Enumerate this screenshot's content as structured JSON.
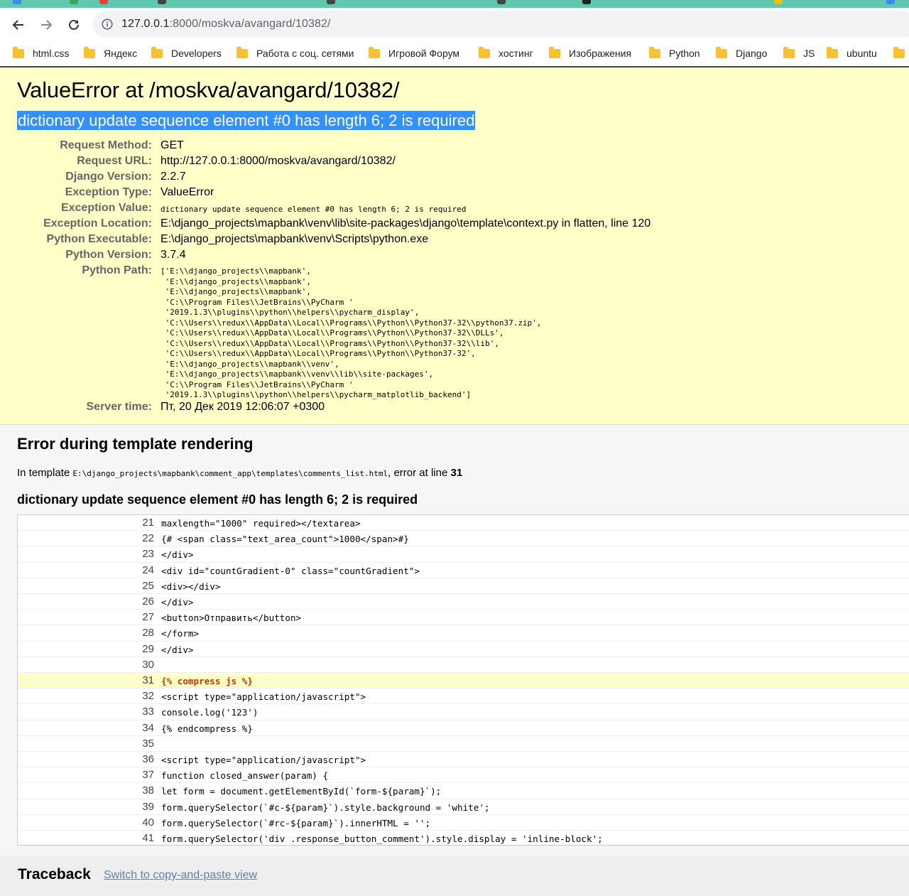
{
  "browser": {
    "url_host": "127.0.0.1",
    "url_path": ":8000/moskva/avangard/10382/",
    "bookmarks": [
      "html.css",
      "Яндекс",
      "Developers",
      "Работа с соц. сетями",
      "Игровой Форум",
      "хостинг",
      "Изображения",
      "Python",
      "Django",
      "JS",
      "ubuntu"
    ]
  },
  "summary": {
    "title": "ValueError at /moskva/avangard/10382/",
    "message": "dictionary update sequence element #0 has length 6; 2 is required",
    "meta": [
      {
        "key": "Request Method:",
        "value": "GET"
      },
      {
        "key": "Request URL:",
        "value": "http://127.0.0.1:8000/moskva/avangard/10382/"
      },
      {
        "key": "Django Version:",
        "value": "2.2.7"
      },
      {
        "key": "Exception Type:",
        "value": "ValueError"
      },
      {
        "key": "Exception Value:",
        "value": "dictionary update sequence element #0 has length 6; 2 is required"
      },
      {
        "key": "Exception Location:",
        "value": "E:\\django_projects\\mapbank\\venv\\lib\\site-packages\\django\\template\\context.py in flatten, line 120"
      },
      {
        "key": "Python Executable:",
        "value": "E:\\django_projects\\mapbank\\venv\\Scripts\\python.exe"
      },
      {
        "key": "Python Version:",
        "value": "3.7.4"
      },
      {
        "key": "Python Path:",
        "value": ""
      },
      {
        "key": "Server time:",
        "value": "Пт, 20 Дек 2019 12:06:07 +0300"
      }
    ],
    "python_path": "['E:\\\\django_projects\\\\mapbank',\n 'E:\\\\django_projects\\\\mapbank',\n 'E:\\\\django_projects\\\\mapbank',\n 'C:\\\\Program Files\\\\JetBrains\\\\PyCharm '\n '2019.1.3\\\\plugins\\\\python\\\\helpers\\\\pycharm_display',\n 'C:\\\\Users\\\\redux\\\\AppData\\\\Local\\\\Programs\\\\Python\\\\Python37-32\\\\python37.zip',\n 'C:\\\\Users\\\\redux\\\\AppData\\\\Local\\\\Programs\\\\Python\\\\Python37-32\\\\DLLs',\n 'C:\\\\Users\\\\redux\\\\AppData\\\\Local\\\\Programs\\\\Python\\\\Python37-32\\\\lib',\n 'C:\\\\Users\\\\redux\\\\AppData\\\\Local\\\\Programs\\\\Python\\\\Python37-32',\n 'E:\\\\django_projects\\\\mapbank\\\\venv',\n 'E:\\\\django_projects\\\\mapbank\\\\venv\\\\lib\\\\site-packages',\n 'C:\\\\Program Files\\\\JetBrains\\\\PyCharm '\n '2019.1.3\\\\plugins\\\\python\\\\helpers\\\\pycharm_matplotlib_backend']"
  },
  "template": {
    "heading": "Error during template rendering",
    "in_template_prefix": "In template ",
    "template_path": "E:\\django_projects\\mapbank\\comment_app\\templates\\comments_list.html",
    "error_at_prefix": ", error at line ",
    "error_line": "31",
    "sub_heading": "dictionary update sequence element #0 has length 6; 2 is required",
    "lines": [
      {
        "num": "21",
        "code": "maxlength=\"1000\" required></textarea>"
      },
      {
        "num": "22",
        "code": "{# <span class=\"text_area_count\">1000</span>#}"
      },
      {
        "num": "23",
        "code": "</div>"
      },
      {
        "num": "24",
        "code": "<div id=\"countGradient-0\" class=\"countGradient\">"
      },
      {
        "num": "25",
        "code": "<div></div>"
      },
      {
        "num": "26",
        "code": "</div>"
      },
      {
        "num": "27",
        "code": "<button>Отправить</button>"
      },
      {
        "num": "28",
        "code": "</form>"
      },
      {
        "num": "29",
        "code": "</div>"
      },
      {
        "num": "30",
        "code": ""
      },
      {
        "num": "31",
        "code": "{% compress js %}",
        "error": true
      },
      {
        "num": "32",
        "code": "<script type=\"application/javascript\">"
      },
      {
        "num": "33",
        "code": "console.log('123')"
      },
      {
        "num": "34",
        "code": "{% endcompress %}"
      },
      {
        "num": "35",
        "code": ""
      },
      {
        "num": "36",
        "code": "<script type=\"application/javascript\">"
      },
      {
        "num": "37",
        "code": "function closed_answer(param) {"
      },
      {
        "num": "38",
        "code": "let form = document.getElementById(`form-${param}`);"
      },
      {
        "num": "39",
        "code": "form.querySelector(`#c-${param}`).style.background = 'white';"
      },
      {
        "num": "40",
        "code": "form.querySelector(`#rc-${param}`).innerHTML = '';"
      },
      {
        "num": "41",
        "code": "form.querySelector('div .response_button_comment').style.display = 'inline-block';"
      }
    ]
  },
  "traceback": {
    "heading": "Traceback",
    "link": "Switch to copy-and-paste view"
  },
  "colors": {
    "summary_bg": "#ffffc8",
    "selection": "#3390ff",
    "error_code": "#cc3300",
    "link": "#5b80b2"
  }
}
